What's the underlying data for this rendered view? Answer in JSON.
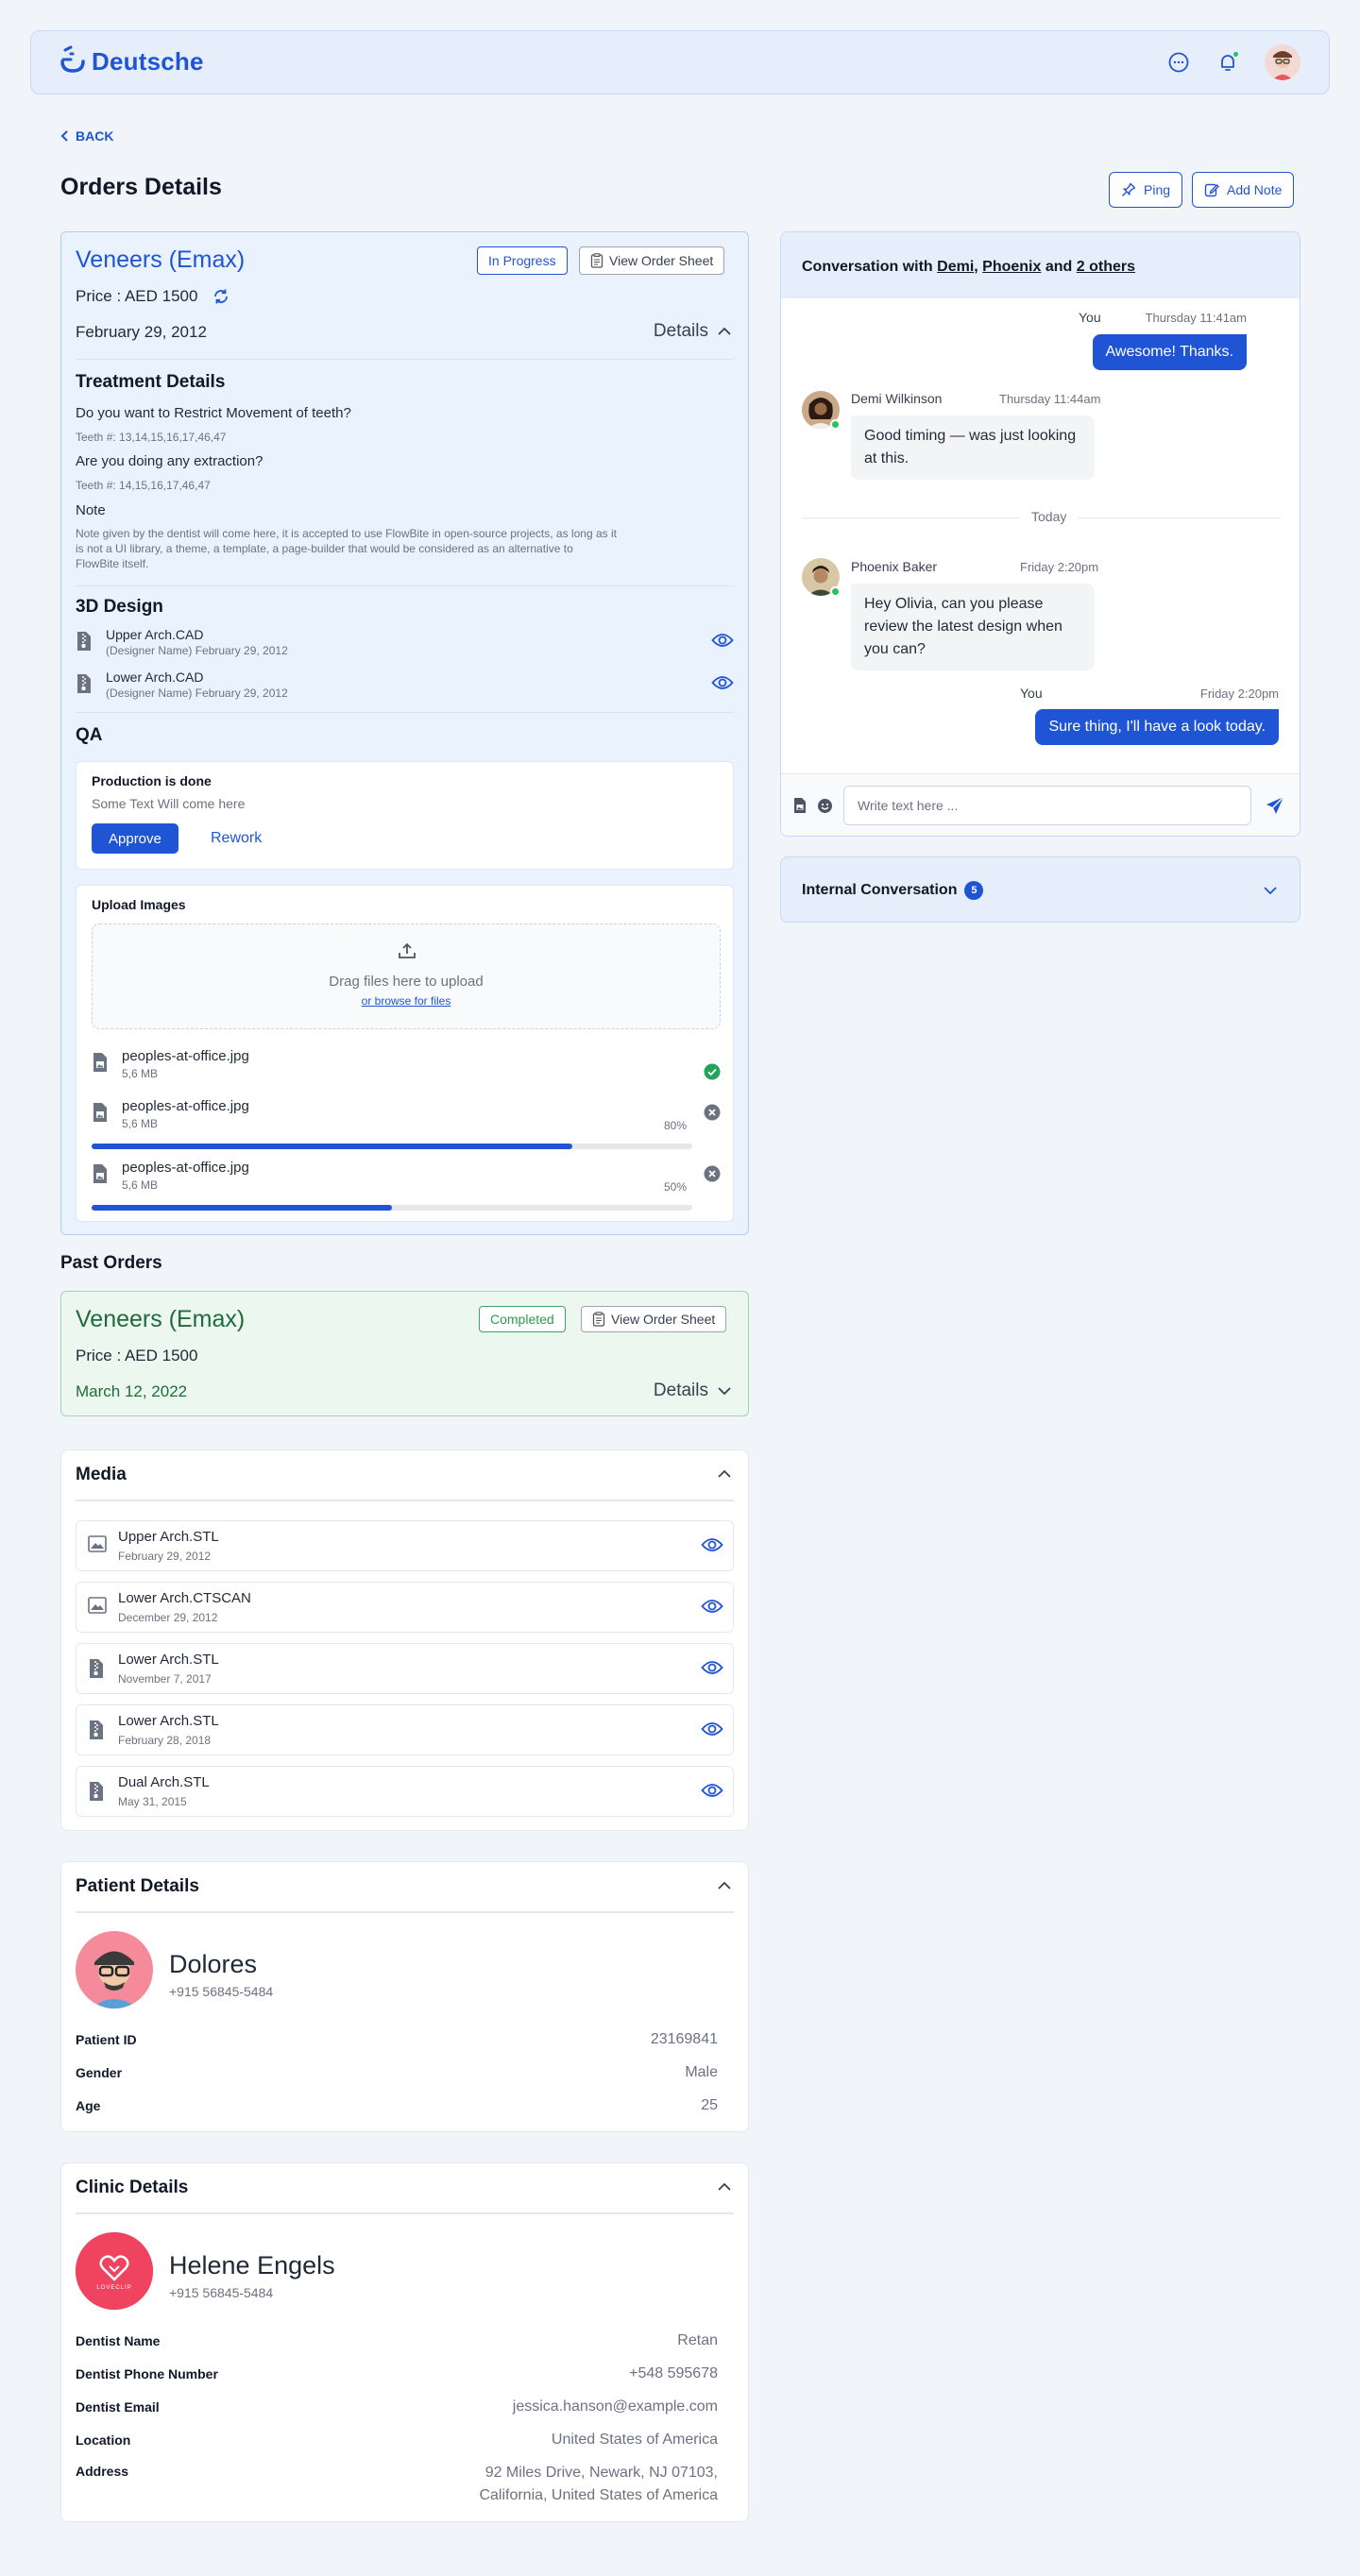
{
  "header": {
    "brand": "Deutsche",
    "icons": [
      "chat-icon",
      "bell-icon"
    ]
  },
  "nav": {
    "back_label": "BACK"
  },
  "page": {
    "title": "Orders Details",
    "ping_label": "Ping",
    "add_note_label": "Add Note"
  },
  "current_order": {
    "title": "Veneers (Emax)",
    "status": "In Progress",
    "view_sheet_label": "View Order Sheet",
    "price": "Price : AED 1500",
    "date": "February 29, 2012",
    "details_label": "Details",
    "treatment": {
      "heading": "Treatment Details",
      "q1": "Do you want to Restrict Movement of teeth?",
      "q1_teeth": "Teeth #: 13,14,15,16,17,46,47",
      "q2": "Are you doing any extraction?",
      "q2_teeth": "Teeth #: 14,15,16,17,46,47",
      "note_label": "Note",
      "note_text": "Note given by the dentist will come here, it is accepted to use FlowBite in open-source projects, as long as it is not a UI library, a theme, a template, a page-builder that would be considered as an alternative to FlowBite itself."
    },
    "design": {
      "heading": "3D Design",
      "files": [
        {
          "name": "Upper Arch.CAD",
          "sub": "(Designer Name) February 29, 2012"
        },
        {
          "name": "Lower Arch.CAD",
          "sub": "(Designer Name) February 29, 2012"
        }
      ]
    },
    "qa": {
      "heading": "QA",
      "box_title": "Production is done",
      "box_text": "Some Text Will come here",
      "approve_label": "Approve",
      "rework_label": "Rework"
    },
    "upload": {
      "heading": "Upload Images",
      "drag_text": "Drag files here to upload",
      "browse_text": "or browse for files",
      "files": [
        {
          "name": "peoples-at-office.jpg",
          "size": "5,6 MB",
          "status": "done"
        },
        {
          "name": "peoples-at-office.jpg",
          "size": "5,6 MB",
          "percent": "80%",
          "progress": 0.8,
          "status": "uploading"
        },
        {
          "name": "peoples-at-office.jpg",
          "size": "5,6 MB",
          "percent": "50%",
          "progress": 0.5,
          "status": "uploading"
        }
      ]
    }
  },
  "past_orders": {
    "heading": "Past Orders",
    "order": {
      "title": "Veneers (Emax)",
      "status": "Completed",
      "view_sheet_label": "View Order Sheet",
      "price": "Price : AED 1500",
      "date": "March 12, 2022",
      "details_label": "Details"
    }
  },
  "media": {
    "heading": "Media",
    "items": [
      {
        "name": "Upper Arch.STL",
        "date": "February 29, 2012",
        "icon": "image-file-icon"
      },
      {
        "name": "Lower Arch.CTSCAN",
        "date": "December 29, 2012",
        "icon": "image-file-icon"
      },
      {
        "name": "Lower Arch.STL",
        "date": "November 7, 2017",
        "icon": "zip-file-icon"
      },
      {
        "name": "Lower Arch.STL",
        "date": "February 28, 2018",
        "icon": "zip-file-icon"
      },
      {
        "name": "Dual Arch.STL",
        "date": "May 31, 2015",
        "icon": "zip-file-icon"
      }
    ]
  },
  "patient": {
    "heading": "Patient Details",
    "name": "Dolores",
    "phone": "+915 56845-5484",
    "fields": [
      {
        "label": "Patient ID",
        "value": "23169841"
      },
      {
        "label": "Gender",
        "value": "Male"
      },
      {
        "label": "Age",
        "value": "25"
      }
    ]
  },
  "clinic": {
    "heading": "Clinic Details",
    "name": "Helene Engels",
    "phone": "+915 56845-5484",
    "logo_text": "LOVECLIP",
    "fields": [
      {
        "label": "Dentist Name",
        "value": "Retan"
      },
      {
        "label": "Dentist Phone Number",
        "value": "+548 595678"
      },
      {
        "label": "Dentist Email",
        "value": "jessica.hanson@example.com"
      },
      {
        "label": "Location",
        "value": "United States of America"
      },
      {
        "label": "Address",
        "value": "92 Miles Drive, Newark, NJ 07103, California, United States of America"
      }
    ]
  },
  "conversation": {
    "prefix": "Conversation with",
    "p1": "Demi",
    "p2": "Phoenix",
    "and": "and",
    "others": "2 others",
    "messages": [
      {
        "from": "You",
        "time": "Thursday 11:41am",
        "text": "Awesome! Thanks."
      },
      {
        "from": "Demi Wilkinson",
        "time": "Thursday 11:44am",
        "text": "Good timing — was just looking at this."
      },
      {
        "from": "Phoenix Baker",
        "time": "Friday 2:20pm",
        "text": "Hey Olivia, can you please review the latest design when you can?"
      },
      {
        "from": "You",
        "time": "Friday 2:20pm",
        "text": "Sure thing, I'll have a look today."
      }
    ],
    "divider": "Today",
    "input_placeholder": "Write text here ..."
  },
  "internal": {
    "label": "Internal Conversation",
    "count": "5"
  },
  "colors": {
    "primary": "#1f55d4",
    "success": "#22c55e",
    "page_bg": "#f1f4f8"
  }
}
